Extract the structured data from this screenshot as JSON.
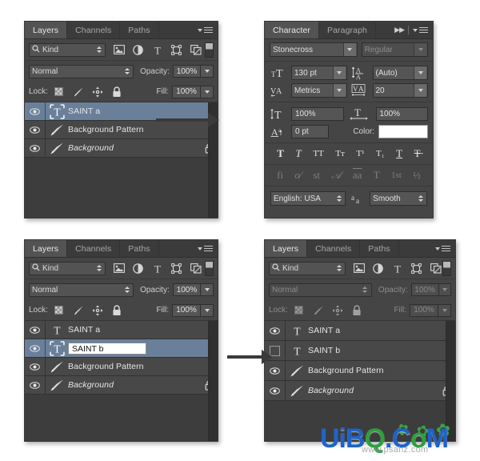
{
  "app": "Adobe Photoshop panels",
  "panels": {
    "layers_top_left": {
      "tabs": [
        {
          "label": "Layers",
          "active": true
        },
        {
          "label": "Channels",
          "active": false
        },
        {
          "label": "Paths",
          "active": false
        }
      ],
      "filter": {
        "kind_label": "Kind",
        "icons": [
          "image-filter-icon",
          "adjustment-filter-icon",
          "type-filter-icon",
          "shape-filter-icon",
          "smartobject-filter-icon"
        ],
        "toggle": "filter-enable-toggle"
      },
      "blend": {
        "mode": "Normal",
        "opacity_label": "Opacity:",
        "opacity_value": "100%"
      },
      "lock": {
        "label": "Lock:",
        "icons": [
          "lock-transparency-icon",
          "lock-image-icon",
          "lock-position-icon",
          "lock-all-icon"
        ],
        "fill_label": "Fill:",
        "fill_value": "100%"
      },
      "layers": [
        {
          "name": "SAINT a",
          "type": "text",
          "visible": true,
          "selected": true,
          "locked": false,
          "italic": false,
          "editing": false
        },
        {
          "name": "Background Pattern",
          "type": "brush",
          "visible": true,
          "selected": false,
          "locked": false,
          "italic": false,
          "editing": false
        },
        {
          "name": "Background",
          "type": "brush",
          "visible": true,
          "selected": false,
          "locked": true,
          "italic": true,
          "editing": false
        }
      ],
      "dimmed": false
    },
    "character": {
      "tabs": [
        {
          "label": "Character",
          "active": true
        },
        {
          "label": "Paragraph",
          "active": false
        }
      ],
      "font_family": "Stonecross",
      "font_style": "Regular",
      "font_size": "130 pt",
      "leading": "(Auto)",
      "kerning": "Metrics",
      "tracking": "20",
      "vertical_scale": "100%",
      "horizontal_scale": "100%",
      "baseline_shift": "0 pt",
      "color_label": "Color:",
      "color_value": "#ffffff",
      "style_buttons_row1": [
        "T",
        "T",
        "TT",
        "Tт",
        "T¹",
        "T₁",
        "T",
        "T̶"
      ],
      "style_buttons_row2": [
        "fi",
        "o⁄",
        "st",
        "𝒜",
        "aa",
        "T",
        "1st",
        "½"
      ],
      "language": "English: USA",
      "antialias_icon": "aa-icon",
      "antialias": "Smooth"
    },
    "layers_bottom_left": {
      "tabs": [
        {
          "label": "Layers",
          "active": true
        },
        {
          "label": "Channels",
          "active": false
        },
        {
          "label": "Paths",
          "active": false
        }
      ],
      "filter": {
        "kind_label": "Kind"
      },
      "blend": {
        "mode": "Normal",
        "opacity_label": "Opacity:",
        "opacity_value": "100%"
      },
      "lock": {
        "label": "Lock:",
        "fill_label": "Fill:",
        "fill_value": "100%"
      },
      "layers": [
        {
          "name": "SAINT a",
          "type": "text",
          "visible": true,
          "selected": false,
          "locked": false,
          "italic": false,
          "editing": false
        },
        {
          "name": "SAINT b",
          "type": "text",
          "visible": true,
          "selected": true,
          "locked": false,
          "italic": false,
          "editing": true
        },
        {
          "name": "Background Pattern",
          "type": "brush",
          "visible": true,
          "selected": false,
          "locked": false,
          "italic": false,
          "editing": false
        },
        {
          "name": "Background",
          "type": "brush",
          "visible": true,
          "selected": false,
          "locked": true,
          "italic": true,
          "editing": false
        }
      ],
      "dimmed": false
    },
    "layers_bottom_right": {
      "tabs": [
        {
          "label": "Layers",
          "active": true
        },
        {
          "label": "Channels",
          "active": false
        },
        {
          "label": "Paths",
          "active": false
        }
      ],
      "filter": {
        "kind_label": "Kind"
      },
      "blend": {
        "mode": "Normal",
        "opacity_label": "Opacity:",
        "opacity_value": "100%"
      },
      "lock": {
        "label": "Lock:",
        "fill_label": "Fill:",
        "fill_value": "100%"
      },
      "layers": [
        {
          "name": "SAINT a",
          "type": "text",
          "visible": true,
          "selected": false,
          "locked": false,
          "italic": false,
          "editing": false
        },
        {
          "name": "SAINT b",
          "type": "text",
          "visible": false,
          "selected": false,
          "locked": false,
          "italic": false,
          "editing": false
        },
        {
          "name": "Background Pattern",
          "type": "brush",
          "visible": true,
          "selected": false,
          "locked": false,
          "italic": false,
          "editing": false
        },
        {
          "name": "Background",
          "type": "brush",
          "visible": true,
          "selected": false,
          "locked": true,
          "italic": true,
          "editing": false
        }
      ],
      "dimmed": true
    }
  },
  "watermark": {
    "text_1": "UiB",
    "text_2": "Q",
    "text_3": ".C",
    "text_4": "o",
    "text_5": "M",
    "sub": "www.psahz.com"
  },
  "colors": {
    "panel_bg": "#454545",
    "tab_active": "#535353",
    "row_bg": "#484848",
    "row_selected": "#6a7f99",
    "text": "#e6e6e6",
    "arrow": "#3a3a3a",
    "watermark_blue": "#1f63c8",
    "watermark_green": "#2f9e3f"
  }
}
